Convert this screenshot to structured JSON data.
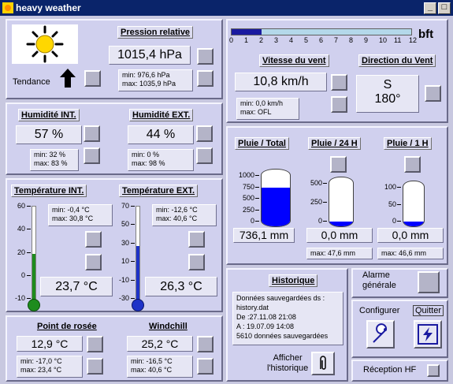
{
  "window": {
    "title": "heavy weather",
    "min_btn": "_",
    "max_btn": "□",
    "close_btn": "×"
  },
  "pressure": {
    "label": "Pression relative",
    "value": "1015,4 hPa",
    "min": "min: 976,6 hPa",
    "max": "max: 1035,9 hPa",
    "trend_label": "Tendance",
    "trend": "up-arrow-icon",
    "forecast": "sunny-icon"
  },
  "wind": {
    "scale_unit": "bft",
    "scale_ticks": [
      "0",
      "1",
      "2",
      "3",
      "4",
      "5",
      "6",
      "7",
      "8",
      "9",
      "10",
      "11",
      "12"
    ],
    "bft_level": 2,
    "speed_label": "Vitesse du vent",
    "speed": "10,8 km/h",
    "min": "min: 0,0 km/h",
    "max": "max: OFL",
    "dir_label": "Direction du Vent",
    "dir": "S",
    "dir_deg": "180°"
  },
  "humidity": {
    "int_label": "Humidité INT.",
    "int_value": "57 %",
    "int_min": "min: 32 %",
    "int_max": "max: 83 %",
    "ext_label": "Humidité EXT.",
    "ext_value": "44 %",
    "ext_min": "min: 0 %",
    "ext_max": "max: 98 %"
  },
  "rain": {
    "total_label": "Pluie / Total",
    "h24_label": "Pluie / 24 H",
    "h1_label": "Pluie / 1 H",
    "total_ticks": [
      "1000",
      "750",
      "500",
      "250",
      "0"
    ],
    "h24_ticks": [
      "500",
      "250",
      "0"
    ],
    "h1_ticks": [
      "100",
      "50",
      "0"
    ],
    "total_value": "736,1 mm",
    "h24_value": "0,0 mm",
    "h1_value": "0,0 mm",
    "h24_max": "max: 47,6 mm",
    "h1_max": "max: 46,6 mm",
    "total_level": 0.736,
    "h24_level": 0,
    "h1_level": 0,
    "fill_color": "#0000ff"
  },
  "temperature": {
    "int_label": "Température INT.",
    "ext_label": "Température EXT.",
    "int_ticks": [
      "60",
      "40",
      "20",
      "0",
      "-10"
    ],
    "ext_ticks": [
      "70",
      "50",
      "30",
      "10",
      "-10",
      "-30"
    ],
    "int_min": "min: -0,4 °C",
    "int_max": "max: 30,8 °C",
    "ext_min": "min: -12,6 °C",
    "ext_max": "max: 40,6 °C",
    "int_value": "23,7 °C",
    "ext_value": "26,3 °C",
    "int_color": "#1e8c1e",
    "ext_color": "#1e32c8"
  },
  "dewpoint": {
    "label": "Point de rosée",
    "value": "12,9 °C",
    "min": "min: -17,0 °C",
    "max": "max: 23,4 °C"
  },
  "windchill": {
    "label": "Windchill",
    "value": "25,2 °C",
    "min": "min: -16,5 °C",
    "max": "max: 40,6 °C"
  },
  "history": {
    "label": "Historique",
    "line1": "Données sauvegardées ds :",
    "line2": "history.dat",
    "line3": "De :27.11.08 21:08",
    "line4": "A : 19.07.09 14:08",
    "line5": "5610 données sauvegardées",
    "show_label_1": "Afficher",
    "show_label_2": "l'historique"
  },
  "alarm": {
    "label_1": "Alarme",
    "label_2": "générale"
  },
  "config": {
    "label": "Configurer"
  },
  "quit": {
    "label": "Quitter"
  },
  "rf": {
    "label": "Réception HF"
  }
}
